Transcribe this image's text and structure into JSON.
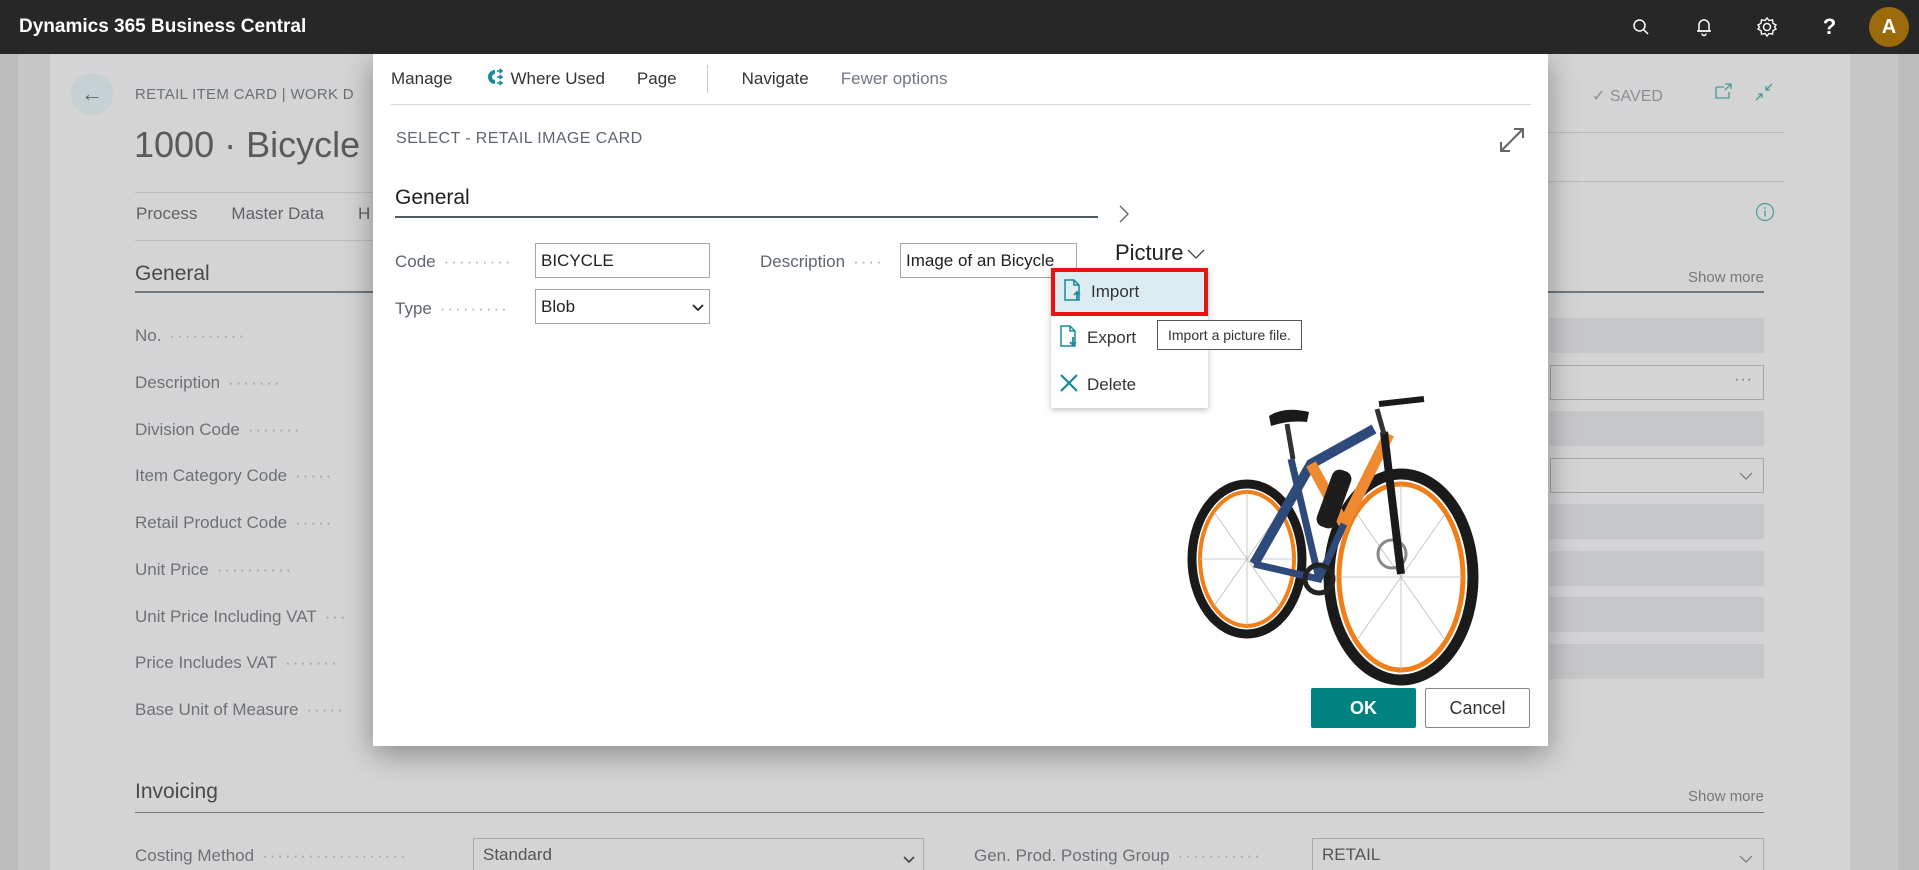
{
  "appbar": {
    "title": "Dynamics 365 Business Central",
    "avatar_initial": "A",
    "icons": [
      "search-icon",
      "bell-icon",
      "gear-icon",
      "help-icon"
    ]
  },
  "background_page": {
    "caption": "RETAIL ITEM CARD | WORK D",
    "title": "1000 · Bicycle",
    "saved_label": "SAVED",
    "actions": [
      "Process",
      "Master Data",
      "H"
    ],
    "general_section": {
      "title": "General",
      "show_more": "Show more",
      "fields": [
        "No.",
        "Description",
        "Division Code",
        "Item Category Code",
        "Retail Product Code",
        "Unit Price",
        "Unit Price Including VAT",
        "Price Includes VAT",
        "Base Unit of Measure"
      ]
    },
    "invoicing_section": {
      "title": "Invoicing",
      "show_more": "Show more",
      "costing_method_label": "Costing Method",
      "costing_method_value": "Standard",
      "gen_prod_posting_group_label": "Gen. Prod. Posting Group",
      "gen_prod_posting_group_value": "RETAIL"
    }
  },
  "dialog": {
    "menu": {
      "manage": "Manage",
      "where_used": "Where Used",
      "page": "Page",
      "navigate": "Navigate",
      "fewer_options": "Fewer options"
    },
    "caption": "SELECT - RETAIL IMAGE CARD",
    "general_title": "General",
    "fields": {
      "code_label": "Code",
      "code_value": "BICYCLE",
      "type_label": "Type",
      "type_value": "Blob",
      "description_label": "Description",
      "description_value": "Image of an Bicycle"
    },
    "picture": {
      "title": "Picture",
      "menu": [
        {
          "label": "Import",
          "icon": "file-import-icon",
          "highlighted": true
        },
        {
          "label": "Export",
          "icon": "file-export-icon",
          "highlighted": false
        },
        {
          "label": "Delete",
          "icon": "delete-x-icon",
          "highlighted": false
        }
      ],
      "tooltip": "Import a picture file."
    },
    "buttons": {
      "ok": "OK",
      "cancel": "Cancel"
    }
  },
  "colors": {
    "accent": "#00837f",
    "appbar": "#272727",
    "avatar": "#9a6a0b",
    "highlight_border": "#ee1111",
    "highlight_fill": "#dcedf1"
  }
}
